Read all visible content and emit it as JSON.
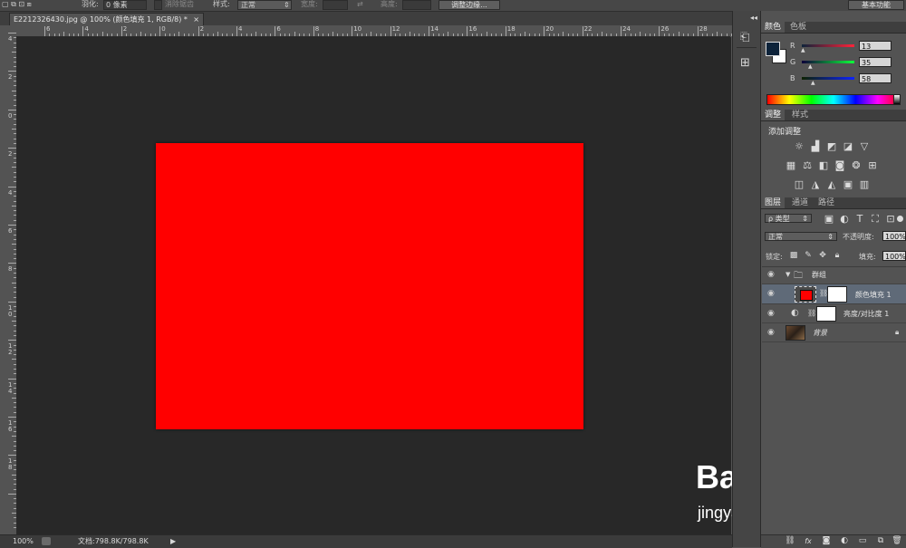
{
  "options_bar": {
    "feather_label": "羽化:",
    "feather_value": "0 像素",
    "antialias_label": "消除锯齿",
    "style_label": "样式:",
    "style_value": "正常",
    "width_label": "宽度:",
    "height_label": "高度:",
    "refine_edge_label": "调整边缘...",
    "workspace_label": "基本功能"
  },
  "document_tab": {
    "title": "E2212326430.jpg @ 100% (颜色填充 1, RGB/8) *",
    "close": "×"
  },
  "rulers": {
    "horizontal_labels": [
      "6",
      "4",
      "2",
      "0",
      "2",
      "4",
      "6",
      "8",
      "10",
      "12",
      "14",
      "16",
      "18",
      "20",
      "22",
      "24",
      "26",
      "28"
    ],
    "vertical_labels": [
      "4",
      "2",
      "0",
      "2",
      "4",
      "6",
      "8",
      "1 0",
      "1 2",
      "1 4",
      "1 6",
      "1 8"
    ]
  },
  "canvas": {
    "fill_color": "#ff0000",
    "background": "#282828"
  },
  "status_bar": {
    "zoom": "100%",
    "doc_info": "文档:798.8K/798.8K",
    "arrow": "▶"
  },
  "color_panel": {
    "tabs": [
      "颜色",
      "色板"
    ],
    "foreground": "#0d233a",
    "background": "#ffffff",
    "r_label": "R",
    "r_value": "13",
    "g_label": "G",
    "g_value": "35",
    "b_label": "B",
    "b_value": "58"
  },
  "adjustments_panel": {
    "tabs": [
      "调整",
      "样式"
    ],
    "title": "添加调整"
  },
  "layers_panel": {
    "tabs": [
      "图层",
      "通道",
      "路径"
    ],
    "filter_label": "ρ 类型",
    "blend_mode": "正常",
    "opacity_label": "不透明度:",
    "opacity_value": "100%",
    "lock_label": "锁定:",
    "fill_label": "填充:",
    "fill_value": "100%",
    "layers": [
      {
        "name": "群组",
        "type": "group"
      },
      {
        "name": "颜色填充 1",
        "type": "fill",
        "color": "#ff0000"
      },
      {
        "name": "亮度/对比度 1",
        "type": "adjustment"
      },
      {
        "name": "背景",
        "type": "background"
      }
    ],
    "footer_icons": [
      "link-icon",
      "fx-icon",
      "mask-icon",
      "adjustment-icon",
      "folder-icon",
      "new-layer-icon",
      "trash-icon"
    ]
  },
  "watermark": {
    "logo": "Bai du 经验",
    "url": "jingyan.baidu.com"
  },
  "accent_colors": {
    "selected_layer": "#5f6a78",
    "panel_bg": "#535353"
  }
}
